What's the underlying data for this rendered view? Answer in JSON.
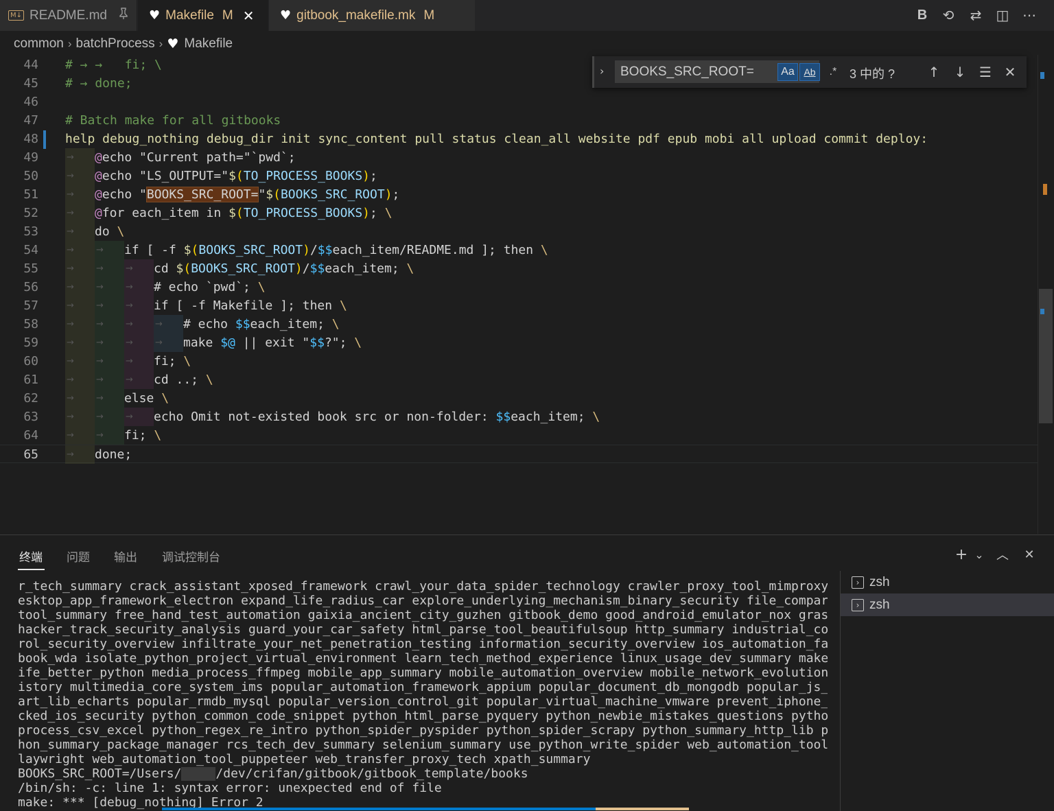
{
  "tabs": [
    {
      "icon": "M↓",
      "name": "README.md",
      "status": "",
      "pinned": true
    },
    {
      "icon": "♥",
      "name": "Makefile",
      "status": "M",
      "active": true
    },
    {
      "icon": "♥",
      "name": "gitbook_makefile.mk",
      "status": "M"
    }
  ],
  "toolbar": {
    "bold": "B",
    "history": "⟲",
    "compare": "⇄",
    "split": "◫",
    "more": "⋯"
  },
  "breadcrumb": [
    "common",
    "batchProcess",
    "Makefile"
  ],
  "find": {
    "query": "BOOKS_SRC_ROOT=",
    "case_label": "Aa",
    "word_label": "Ab",
    "regex_label": ".*",
    "count": "3 中的 ?"
  },
  "editor": {
    "lines": [
      {
        "n": "44",
        "indent": 0,
        "tokens": [
          [
            "#",
            "com"
          ],
          [
            " → →  ",
            "ws"
          ],
          [
            " fi; \\",
            "com"
          ]
        ]
      },
      {
        "n": "45",
        "indent": 0,
        "tokens": [
          [
            "# → done;",
            "com"
          ]
        ]
      },
      {
        "n": "46",
        "indent": 0,
        "tokens": []
      },
      {
        "n": "47",
        "indent": 0,
        "tokens": [
          [
            "# Batch make for all gitbooks",
            "com"
          ]
        ]
      },
      {
        "n": "48",
        "indent": 0,
        "tokens": [
          [
            "help debug_nothing debug_dir init sync_content pull status clean_all website pdf epub mobi all upload commit deploy:",
            "kw"
          ]
        ]
      },
      {
        "n": "49",
        "indent": 1,
        "tokens": [
          [
            "@",
            "at"
          ],
          [
            "echo ",
            ""
          ],
          [
            "\"Current path=\"`pwd`;",
            ""
          ]
        ]
      },
      {
        "n": "50",
        "indent": 1,
        "tokens": [
          [
            "@",
            "at"
          ],
          [
            "echo \"LS_OUTPUT=\"",
            ""
          ],
          [
            "$",
            "dollar"
          ],
          [
            "(",
            "paren"
          ],
          [
            "TO_PROCESS_BOOKS",
            "fn"
          ],
          [
            ")",
            "paren"
          ],
          [
            ";",
            ""
          ]
        ]
      },
      {
        "n": "51",
        "indent": 1,
        "tokens": [
          [
            "@",
            "at"
          ],
          [
            "echo \"",
            ""
          ],
          [
            "BOOKS_SRC_ROOT=",
            "hl"
          ],
          [
            "\"",
            ""
          ],
          [
            "$",
            "dollar"
          ],
          [
            "(",
            "paren"
          ],
          [
            "BOOKS_SRC_ROOT",
            "fn"
          ],
          [
            ")",
            "paren"
          ],
          [
            ";",
            ""
          ]
        ]
      },
      {
        "n": "52",
        "indent": 1,
        "tokens": [
          [
            "@",
            "at"
          ],
          [
            "for each_item in ",
            ""
          ],
          [
            "$",
            "dollar"
          ],
          [
            "(",
            "paren"
          ],
          [
            "TO_PROCESS_BOOKS",
            "fn"
          ],
          [
            ")",
            "paren"
          ],
          [
            "; ",
            ""
          ],
          [
            "\\",
            "bs"
          ]
        ]
      },
      {
        "n": "53",
        "indent": 1,
        "tokens": [
          [
            "do ",
            ""
          ],
          [
            "\\",
            "bs"
          ]
        ]
      },
      {
        "n": "54",
        "indent": 2,
        "tokens": [
          [
            "if [ -f ",
            ""
          ],
          [
            "$",
            "dollar"
          ],
          [
            "(",
            "paren"
          ],
          [
            "BOOKS_SRC_ROOT",
            "fn"
          ],
          [
            ")",
            "paren"
          ],
          [
            "/",
            ""
          ],
          [
            "$$",
            "var"
          ],
          [
            "each_item/README.md ]; then ",
            ""
          ],
          [
            "\\",
            "bs"
          ]
        ]
      },
      {
        "n": "55",
        "indent": 3,
        "tokens": [
          [
            "cd ",
            ""
          ],
          [
            "$",
            "dollar"
          ],
          [
            "(",
            "paren"
          ],
          [
            "BOOKS_SRC_ROOT",
            "fn"
          ],
          [
            ")",
            "paren"
          ],
          [
            "/",
            ""
          ],
          [
            "$$",
            "var"
          ],
          [
            "each_item; ",
            ""
          ],
          [
            "\\",
            "bs"
          ]
        ]
      },
      {
        "n": "56",
        "indent": 3,
        "tokens": [
          [
            "# echo `pwd`; ",
            ""
          ],
          [
            "\\",
            "bs"
          ]
        ]
      },
      {
        "n": "57",
        "indent": 3,
        "tokens": [
          [
            "if [ -f Makefile ]; then ",
            ""
          ],
          [
            "\\",
            "bs"
          ]
        ]
      },
      {
        "n": "58",
        "indent": 4,
        "tokens": [
          [
            "# echo ",
            ""
          ],
          [
            "$$",
            "var"
          ],
          [
            "each_item; ",
            ""
          ],
          [
            "\\",
            "bs"
          ]
        ]
      },
      {
        "n": "59",
        "indent": 4,
        "tokens": [
          [
            "make ",
            ""
          ],
          [
            "$@",
            "var"
          ],
          [
            " || exit \"",
            ""
          ],
          [
            "$$",
            "var"
          ],
          [
            "?\"; ",
            ""
          ],
          [
            "\\",
            "bs"
          ]
        ]
      },
      {
        "n": "60",
        "indent": 3,
        "tokens": [
          [
            "fi; ",
            ""
          ],
          [
            "\\",
            "bs"
          ]
        ]
      },
      {
        "n": "61",
        "indent": 3,
        "tokens": [
          [
            "cd ..; ",
            ""
          ],
          [
            "\\",
            "bs"
          ]
        ]
      },
      {
        "n": "62",
        "indent": 2,
        "tokens": [
          [
            "else ",
            ""
          ],
          [
            "\\",
            "bs"
          ]
        ]
      },
      {
        "n": "63",
        "indent": 3,
        "tokens": [
          [
            "echo Omit not-existed book src or non-folder: ",
            ""
          ],
          [
            "$$",
            "var"
          ],
          [
            "each_item; ",
            ""
          ],
          [
            "\\",
            "bs"
          ]
        ]
      },
      {
        "n": "64",
        "indent": 2,
        "tokens": [
          [
            "fi; ",
            ""
          ],
          [
            "\\",
            "bs"
          ]
        ]
      },
      {
        "n": "65",
        "indent": 1,
        "active": true,
        "tokens": [
          [
            "done;",
            ""
          ]
        ]
      }
    ]
  },
  "panel": {
    "tabs": [
      "终端",
      "问题",
      "输出",
      "调试控制台"
    ],
    "active_tab": "终端",
    "buttons": {
      "add": "+",
      "dropdown": "⌄",
      "maximize": "︿",
      "close": "✕"
    },
    "terminal_lines": [
      "r_tech_summary crack_assistant_xposed_framework crawl_your_data_spider_technology crawler_proxy_tool_mimproxy d",
      "esktop_app_framework_electron expand_life_radius_car explore_underlying_mechanism_binary_security file_compare_",
      "tool_summary free_hand_test_automation gaixia_ancient_city_guzhen gitbook_demo good_android_emulator_nox grasp_",
      "hacker_track_security_analysis guard_your_car_safety html_parse_tool_beautifulsoup http_summary industrial_cont",
      "rol_security_overview infiltrate_your_net_penetration_testing information_security_overview ios_automation_face",
      "book_wda isolate_python_project_virtual_environment learn_tech_method_experience linux_usage_dev_summary make_l",
      "ife_better_python media_process_ffmpeg mobile_app_summary mobile_automation_overview mobile_network_evolution_h",
      "istory multimedia_core_system_ims popular_automation_framework_appium popular_document_db_mongodb popular_js_ch",
      "art_lib_echarts popular_rmdb_mysql popular_version_control_git popular_virtual_machine_vmware prevent_iphone_ha",
      "cked_ios_security python_common_code_snippet python_html_parse_pyquery python_newbie_mistakes_questions python_",
      "process_csv_excel python_regex_re_intro python_spider_pyspider python_spider_scrapy python_summary_http_lib pyt",
      "hon_summary_package_manager rcs_tech_dev_summary selenium_summary use_python_write_spider web_automation_tool_p",
      "laywright web_automation_tool_puppeteer web_transfer_proxy_tech xpath_summary"
    ],
    "root_line_prefix": "BOOKS_SRC_ROOT=/Users/",
    "root_line_suffix": "/dev/crifan/gitbook/gitbook_template/books",
    "error_lines": [
      "/bin/sh: -c: line 1: syntax error: unexpected end of file",
      "make: *** [debug_nothing] Error 2"
    ],
    "terminals": [
      "zsh",
      "zsh"
    ],
    "selected_terminal": 1
  },
  "colors": {
    "comment": "#6a9955",
    "keyword": "#dcdcaa",
    "at": "#c586c0",
    "variable": "#4fc1ff",
    "function_var": "#9cdcfe",
    "paren": "#ffd700",
    "highlight": "#623315",
    "modified": "#e2c08d"
  }
}
